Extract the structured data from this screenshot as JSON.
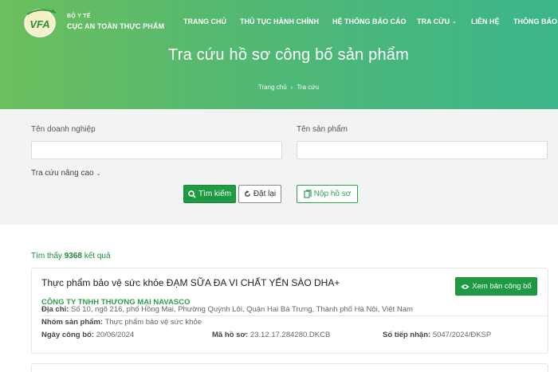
{
  "logo": {
    "badge_text": "VFA",
    "ministry": "BỘ Y TẾ",
    "agency": "CỤC AN TOÀN THỰC PHẨM"
  },
  "nav": {
    "items": [
      "TRANG CHỦ",
      "THỦ TỤC HÀNH CHÍNH",
      "HỆ THỐNG BÁO CÁO",
      "TRA CỨU",
      "LIÊN HỆ",
      "THÔNG BÁO"
    ],
    "dropdown_caret": "⌄"
  },
  "hero": {
    "title": "Tra cứu hồ sơ công bố sản phẩm",
    "breadcrumb": [
      "Trang chủ",
      "Tra cứu"
    ],
    "breadcrumb_sep": "›"
  },
  "search": {
    "company_label": "Tên doanh nghiệp",
    "company_value": "",
    "product_label": "Tên sản phẩm",
    "product_value": "",
    "advanced_label": "Tra cứu nâng cao",
    "search_button": "Tìm kiếm",
    "reset_button": "Đặt lại",
    "submit_button": "Nộp hồ sơ"
  },
  "results": {
    "found_prefix": "Tìm thấy",
    "count": "9368",
    "found_suffix": "kết quả",
    "items": [
      {
        "product": "Thực phẩm bảo vệ sức khỏe ĐẠM SỮA ĐA VI CHẤT YẾN SÀO DHA+",
        "view_button": "Xem bản công bố",
        "company": "CÔNG TY TNHH THƯƠNG MẠI NAVASCO",
        "address_label": "Địa chỉ:",
        "address": "Số 10, ngõ 216, phố Hồng Mai, Phường Quỳnh Lôi, Quận Hai Bà Trưng, Thành phố Hà Nội, Việt Nam",
        "group_label": "Nhóm sản phẩm:",
        "group": "Thực phẩm bảo vệ sức khỏe",
        "date_label": "Ngày công bố:",
        "date": "20/06/2024",
        "code_label": "Mã hồ sơ:",
        "code": "23.12.17.284280.DKCB",
        "receipt_label": "Số tiếp nhận:",
        "receipt": "5047/2024/ĐKSP"
      }
    ]
  },
  "colors": {
    "primary_green": "#1e9b42",
    "header_gradient_start": "#6cbf5d",
    "header_gradient_end": "#3bb58a",
    "panel_bg": "#f2f3f3"
  }
}
